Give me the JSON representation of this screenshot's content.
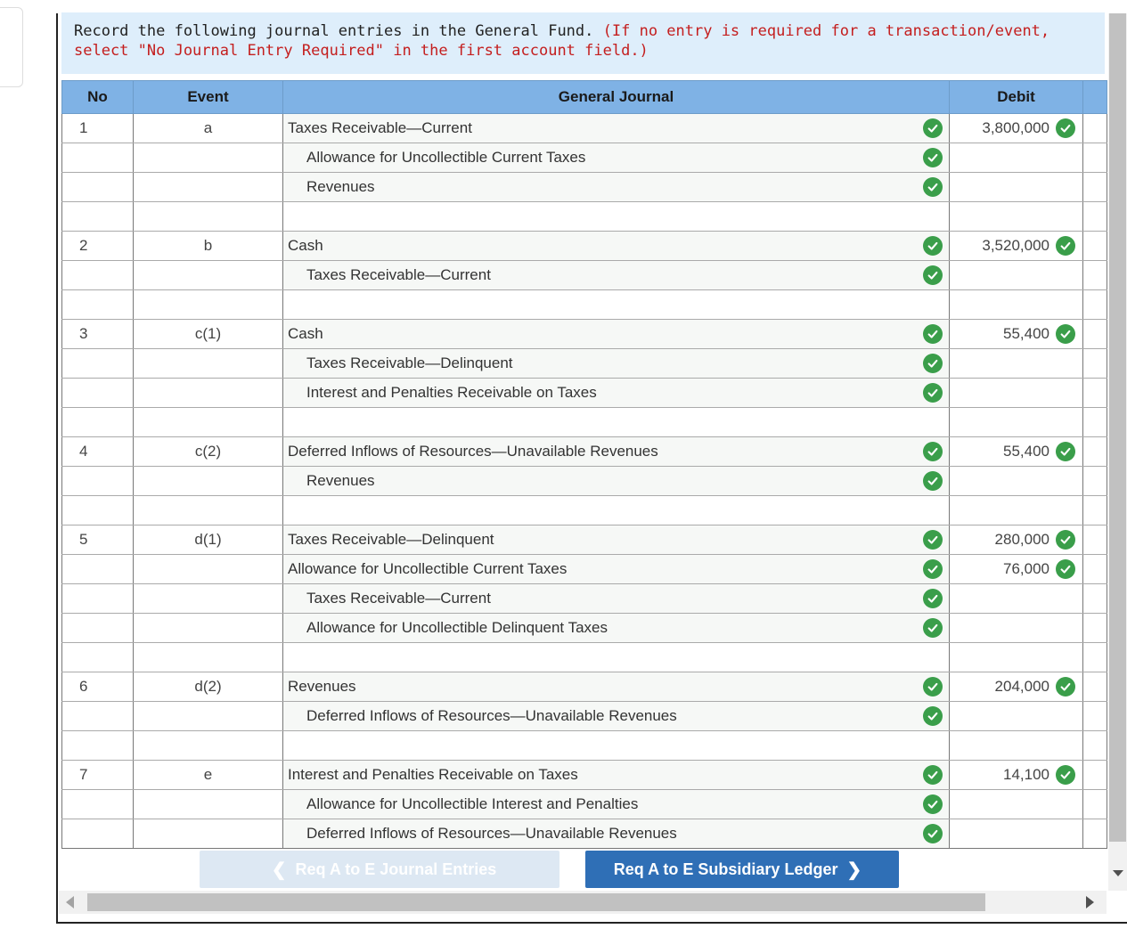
{
  "instructions": {
    "text": "Record the following journal entries in the General Fund.",
    "hint": "(If no entry is required for a transaction/event, select \"No Journal Entry Required\" in the first account field.)"
  },
  "table": {
    "headers": {
      "no": "No",
      "event": "Event",
      "journal": "General Journal",
      "debit": "Debit"
    },
    "rows": [
      {
        "no": "1",
        "event": "a",
        "account": "Taxes Receivable—Current",
        "indent": false,
        "check": true,
        "debit": "3,800,000",
        "debit_check": true
      },
      {
        "no": "",
        "event": "",
        "account": "Allowance for Uncollectible Current Taxes",
        "indent": true,
        "check": true,
        "debit": "",
        "debit_check": false
      },
      {
        "no": "",
        "event": "",
        "account": "Revenues",
        "indent": true,
        "check": true,
        "debit": "",
        "debit_check": false
      },
      {
        "no": "",
        "event": "",
        "account": "",
        "indent": false,
        "check": false,
        "debit": "",
        "debit_check": false
      },
      {
        "no": "2",
        "event": "b",
        "account": "Cash",
        "indent": false,
        "check": true,
        "debit": "3,520,000",
        "debit_check": true
      },
      {
        "no": "",
        "event": "",
        "account": "Taxes Receivable—Current",
        "indent": true,
        "check": true,
        "debit": "",
        "debit_check": false
      },
      {
        "no": "",
        "event": "",
        "account": "",
        "indent": false,
        "check": false,
        "debit": "",
        "debit_check": false
      },
      {
        "no": "3",
        "event": "c(1)",
        "account": "Cash",
        "indent": false,
        "check": true,
        "debit": "55,400",
        "debit_check": true
      },
      {
        "no": "",
        "event": "",
        "account": "Taxes Receivable—Delinquent",
        "indent": true,
        "check": true,
        "debit": "",
        "debit_check": false
      },
      {
        "no": "",
        "event": "",
        "account": "Interest and Penalties Receivable on Taxes",
        "indent": true,
        "check": true,
        "debit": "",
        "debit_check": false
      },
      {
        "no": "",
        "event": "",
        "account": "",
        "indent": false,
        "check": false,
        "debit": "",
        "debit_check": false
      },
      {
        "no": "4",
        "event": "c(2)",
        "account": "Deferred Inflows of Resources—Unavailable Revenues",
        "indent": false,
        "check": true,
        "debit": "55,400",
        "debit_check": true
      },
      {
        "no": "",
        "event": "",
        "account": "Revenues",
        "indent": true,
        "check": true,
        "debit": "",
        "debit_check": false
      },
      {
        "no": "",
        "event": "",
        "account": "",
        "indent": false,
        "check": false,
        "debit": "",
        "debit_check": false
      },
      {
        "no": "5",
        "event": "d(1)",
        "account": "Taxes Receivable—Delinquent",
        "indent": false,
        "check": true,
        "debit": "280,000",
        "debit_check": true
      },
      {
        "no": "",
        "event": "",
        "account": "Allowance for Uncollectible Current Taxes",
        "indent": false,
        "check": true,
        "debit": "76,000",
        "debit_check": true
      },
      {
        "no": "",
        "event": "",
        "account": "Taxes Receivable—Current",
        "indent": true,
        "check": true,
        "debit": "",
        "debit_check": false
      },
      {
        "no": "",
        "event": "",
        "account": "Allowance for Uncollectible Delinquent Taxes",
        "indent": true,
        "check": true,
        "debit": "",
        "debit_check": false
      },
      {
        "no": "",
        "event": "",
        "account": "",
        "indent": false,
        "check": false,
        "debit": "",
        "debit_check": false
      },
      {
        "no": "6",
        "event": "d(2)",
        "account": "Revenues",
        "indent": false,
        "check": true,
        "debit": "204,000",
        "debit_check": true
      },
      {
        "no": "",
        "event": "",
        "account": "Deferred Inflows of Resources—Unavailable Revenues",
        "indent": true,
        "check": true,
        "debit": "",
        "debit_check": false
      },
      {
        "no": "",
        "event": "",
        "account": "",
        "indent": false,
        "check": false,
        "debit": "",
        "debit_check": false
      },
      {
        "no": "7",
        "event": "e",
        "account": "Interest and Penalties Receivable on Taxes",
        "indent": false,
        "check": true,
        "debit": "14,100",
        "debit_check": true
      },
      {
        "no": "",
        "event": "",
        "account": "Allowance for Uncollectible Interest and Penalties",
        "indent": true,
        "check": true,
        "debit": "",
        "debit_check": false
      },
      {
        "no": "",
        "event": "",
        "account": "Deferred Inflows of Resources—Unavailable Revenues",
        "indent": true,
        "check": true,
        "debit": "",
        "debit_check": false
      }
    ]
  },
  "nav": {
    "prev_label": "Req A to E Journal Entries",
    "next_label": "Req A to E Subsidiary Ledger"
  },
  "icons": {
    "check": "check-circle-icon",
    "prev": "chevron-left-icon",
    "next": "chevron-right-icon"
  },
  "colors": {
    "header_bg": "#7fb2e5",
    "instructions_bg": "#deeefb",
    "hint_red": "#c41e1e",
    "check_green": "#3a9e4a",
    "next_button": "#2f6fb6",
    "prev_button_disabled": "#dde8f3"
  }
}
